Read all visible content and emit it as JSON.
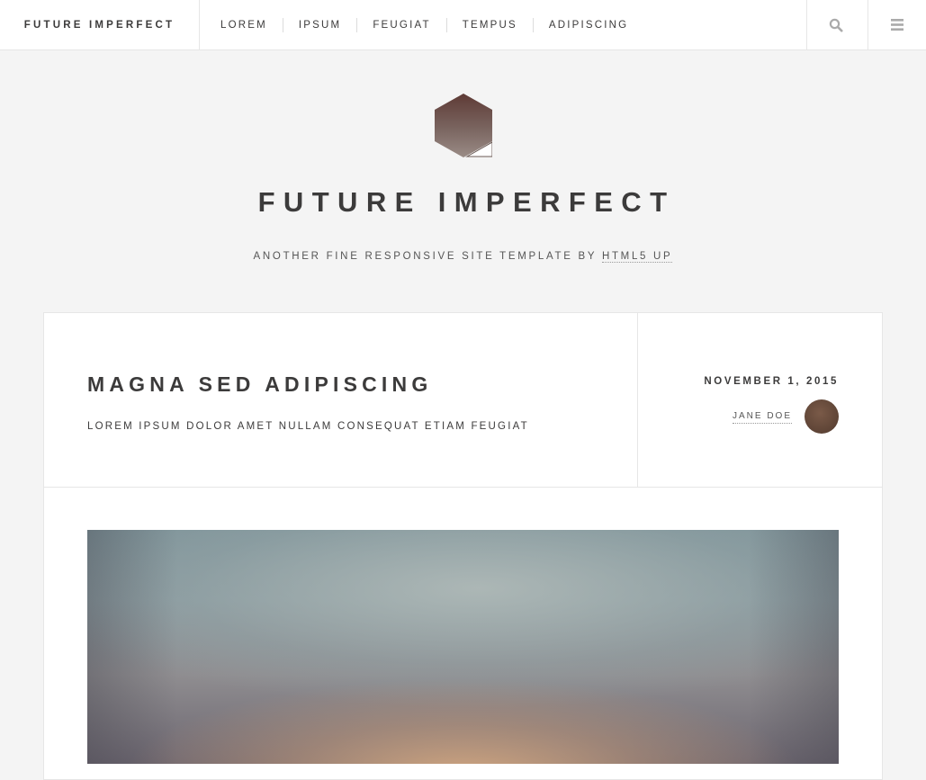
{
  "header": {
    "brand": "FUTURE IMPERFECT",
    "nav": [
      {
        "label": "LOREM"
      },
      {
        "label": "IPSUM"
      },
      {
        "label": "FEUGIAT"
      },
      {
        "label": "TEMPUS"
      },
      {
        "label": "ADIPISCING"
      }
    ],
    "tools": {
      "search_icon": "search-icon",
      "menu_icon": "hamburger-menu-icon"
    }
  },
  "intro": {
    "logo_icon": "hexagon-logo-icon",
    "title": "FUTURE IMPERFECT",
    "tagline_prefix": "ANOTHER FINE RESPONSIVE SITE TEMPLATE BY ",
    "tagline_link": "HTML5 UP"
  },
  "post": {
    "title": "MAGNA SED ADIPISCING",
    "subtitle": "LOREM IPSUM DOLOR AMET NULLAM CONSEQUAT ETIAM FEUGIAT",
    "date": "NOVEMBER 1, 2015",
    "author": "JANE DOE"
  },
  "colors": {
    "text": "#3c3b3b",
    "background": "#f4f4f4",
    "panel": "#ffffff",
    "border": "#e6e6e6",
    "icon": "#aaaaaa"
  }
}
